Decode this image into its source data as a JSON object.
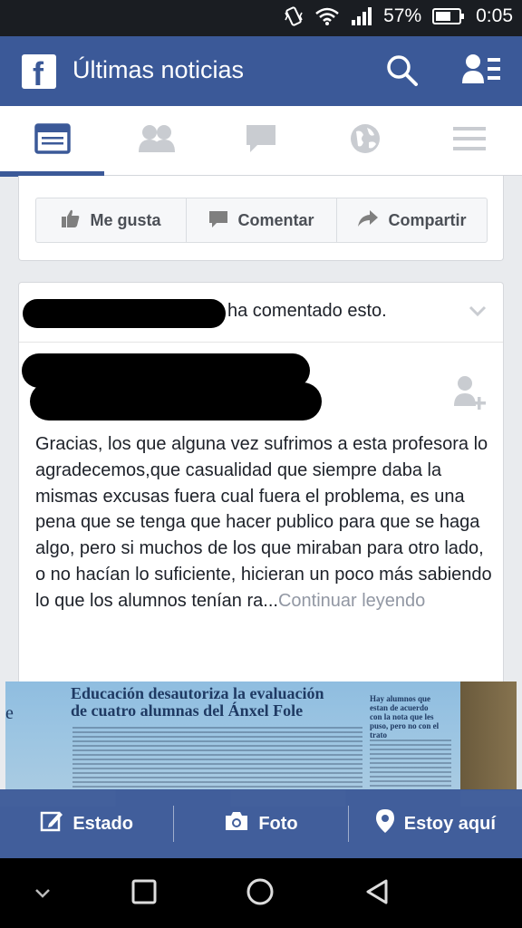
{
  "status_bar": {
    "battery": "57%",
    "time": "0:05"
  },
  "app_bar": {
    "title": "Últimas noticias",
    "logo": "f"
  },
  "tabs": [
    "news-feed-icon",
    "friend-requests-icon",
    "messages-icon",
    "notifications-globe-icon",
    "menu-icon"
  ],
  "actions": {
    "like": "Me gusta",
    "comment": "Comentar",
    "share": "Compartir"
  },
  "post": {
    "activity": "ha comentado esto.",
    "text": "Gracias, los que alguna vez sufrimos a esta profesora lo agradecemos,que casualidad que siempre daba la mismas excusas fuera cual fuera el problema, es una pena que se tenga que hacer publico para que se haga algo, pero si muchos de los que miraban para otro lado, o no hacían lo suficiente, hicieran un poco más sabiendo lo que los alumnos tenían ra...",
    "continue": "Continuar leyendo"
  },
  "article_image": {
    "headline_1": "Educación desautoriza la evaluación",
    "headline_2": "de cuatro alumnas del Ánxel Fole",
    "side_text": "Hay alumnos que estan de acuerdo con la nota que les puso, pero no con el trato",
    "edge_letter": "e"
  },
  "composer": {
    "status": "Estado",
    "photo": "Foto",
    "checkin": "Estoy aquí"
  },
  "colors": {
    "brand": "#3b5998",
    "background": "#e9ebee"
  }
}
